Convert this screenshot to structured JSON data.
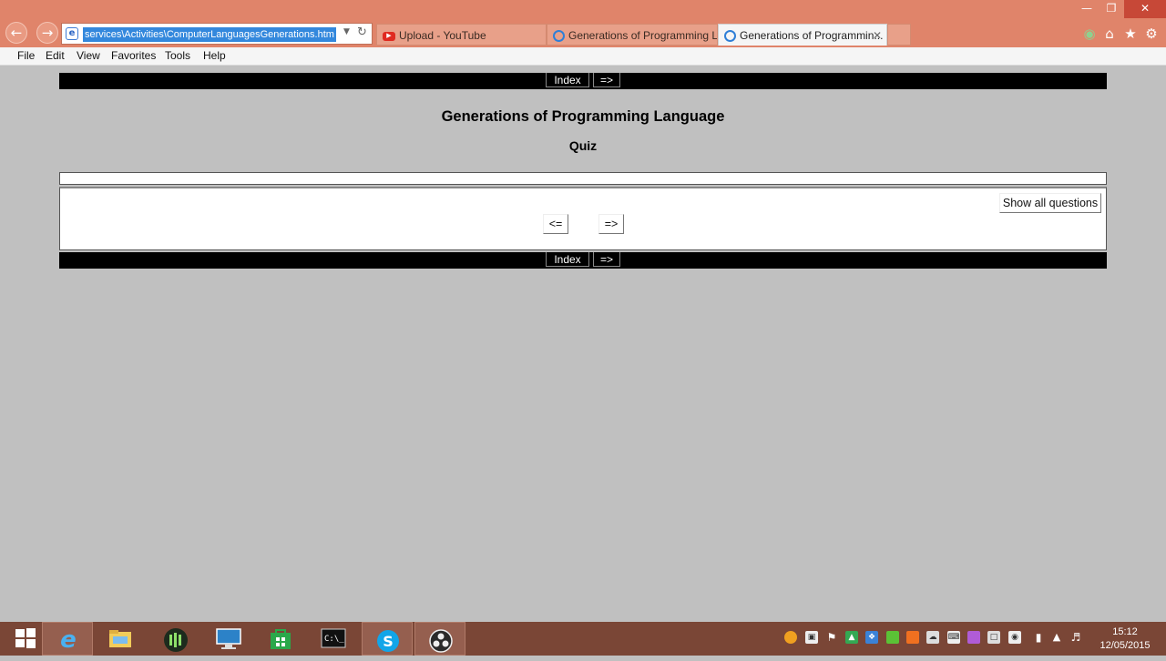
{
  "browser": {
    "address_url": "services\\Activities\\ComputerLanguagesGenerations.htm",
    "tabs": [
      {
        "title": "Upload - YouTube",
        "icon": "youtube-icon",
        "active": false
      },
      {
        "title": "Generations of Programming L...",
        "icon": "ie-page-icon",
        "active": false
      },
      {
        "title": "Generations of Programmin...",
        "icon": "ie-page-icon",
        "active": true
      }
    ],
    "menu": [
      "File",
      "Edit",
      "View",
      "Favorites",
      "Tools",
      "Help"
    ],
    "accent_color": "#e0846a"
  },
  "page": {
    "nav": {
      "index_label": "Index",
      "next_label": "=>"
    },
    "title": "Generations of Programming Language",
    "subtitle": "Quiz",
    "show_all_label": "Show all questions",
    "prev_label": "<=",
    "next_label": "=>"
  },
  "taskbar": {
    "apps": [
      "start-icon",
      "internet-explorer-icon",
      "file-explorer-icon",
      "media-app-icon",
      "remote-desktop-icon",
      "store-icon",
      "command-prompt-icon",
      "skype-icon",
      "obs-icon"
    ],
    "clock": {
      "time": "15:12",
      "date": "12/05/2015"
    }
  }
}
